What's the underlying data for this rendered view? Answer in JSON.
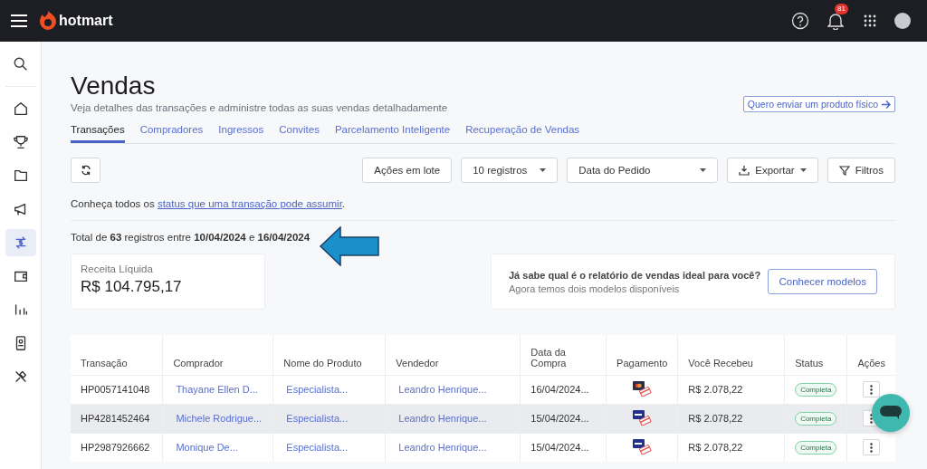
{
  "topbar": {
    "brand": "hotmart",
    "notifications": "81"
  },
  "sidebar": {
    "items": [
      {
        "selected": false
      },
      {
        "selected": false
      },
      {
        "selected": false
      },
      {
        "selected": false
      },
      {
        "selected": false
      },
      {
        "selected": true
      },
      {
        "selected": false
      },
      {
        "selected": false
      },
      {
        "selected": false
      },
      {
        "selected": false
      }
    ]
  },
  "page": {
    "title": "Vendas",
    "subtitle": "Veja detalhes das transações e administre todas as suas vendas detalhadamente",
    "physical_button": "Quero enviar um produto físico"
  },
  "tabs": [
    {
      "label": "Transações",
      "selected": true
    },
    {
      "label": "Compradores",
      "selected": false
    },
    {
      "label": "Ingressos",
      "selected": false
    },
    {
      "label": "Convites",
      "selected": false
    },
    {
      "label": "Parcelamento Inteligente",
      "selected": false
    },
    {
      "label": "Recuperação de Vendas",
      "selected": false
    }
  ],
  "toolbar": {
    "batch": "Ações em lote",
    "page_size": "10 registros",
    "date_field": "Data do Pedido",
    "export": "Exportar",
    "filters": "Filtros"
  },
  "info": {
    "before": "Conheça todos os ",
    "link": "status que uma transação pode assumir",
    "after": "."
  },
  "total": "Total de **63** registros entre **10/04/2024** e **16/04/2024**",
  "revenue": {
    "label": "Receita Líquida",
    "value": "R$ 104.795,17"
  },
  "promo": {
    "title": "Já sabe qual é o relatório de vendas ideal para você?",
    "text": "Agora temos dois modelos disponíveis",
    "button": "Conhecer modelos"
  },
  "table": {
    "columns": [
      "Transação",
      "Comprador",
      "Nome do Produto",
      "Vendedor",
      "Data da Compra",
      "Pagamento",
      "Você Recebeu",
      "Status",
      "Ações"
    ],
    "rows": [
      {
        "transaction": "HP0057141048",
        "buyer": "Thayane Ellen D...",
        "product": "Especialista...",
        "seller": "Leandro Henrique...",
        "date": "16/04/2024...",
        "payment": {
          "kind": "mastercard"
        },
        "received": "R$ 2.078,22",
        "status": "Completa",
        "highlighted": false
      },
      {
        "transaction": "HP4281452464",
        "buyer": "Michele Rodrigue...",
        "product": "Especialista...",
        "seller": "Leandro Henrique...",
        "date": "15/04/2024...",
        "payment": {
          "kind": "visa"
        },
        "received": "R$ 2.078,22",
        "status": "Completa",
        "highlighted": true
      },
      {
        "transaction": "HP2987926662",
        "buyer": "Monique De...",
        "product": "Especialista...",
        "seller": "Leandro Henrique...",
        "date": "15/04/2024...",
        "payment": {
          "kind": "visa"
        },
        "received": "R$ 2.078,22",
        "status": "Completa",
        "highlighted": false
      }
    ]
  }
}
